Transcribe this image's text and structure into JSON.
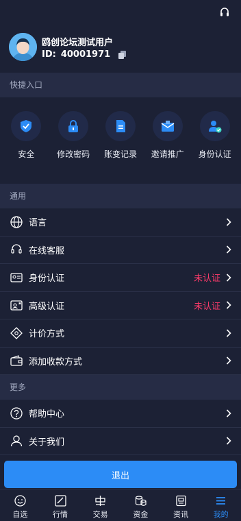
{
  "colors": {
    "background": "#1c2135",
    "section": "#262c45",
    "accent": "#2c8cf6",
    "warning": "#ff3b6b"
  },
  "header": {
    "support_icon": "headset-icon"
  },
  "profile": {
    "username": "鸥创论坛测试用户",
    "id_label": "ID:",
    "id_value": "40001971",
    "avatar_icon": "avatar-icon",
    "copy_icon": "copy-icon"
  },
  "quick_section": {
    "title": "快捷入口",
    "items": [
      {
        "label": "安全",
        "icon": "shield-icon"
      },
      {
        "label": "修改密码",
        "icon": "lock-icon"
      },
      {
        "label": "账变记录",
        "icon": "document-icon"
      },
      {
        "label": "邀请推广",
        "icon": "mail-icon"
      },
      {
        "label": "身份认证",
        "icon": "user-verified-icon"
      }
    ]
  },
  "general_section": {
    "title": "通用",
    "items": [
      {
        "label": "语言",
        "status": "",
        "icon": "globe-icon"
      },
      {
        "label": "在线客服",
        "status": "",
        "icon": "headset-icon"
      },
      {
        "label": "身份认证",
        "status": "未认证",
        "icon": "id-card-icon"
      },
      {
        "label": "高级认证",
        "status": "未认证",
        "icon": "id-card-star-icon"
      },
      {
        "label": "计价方式",
        "status": "",
        "icon": "currency-icon"
      },
      {
        "label": "添加收款方式",
        "status": "",
        "icon": "wallet-icon"
      }
    ]
  },
  "more_section": {
    "title": "更多",
    "items": [
      {
        "label": "帮助中心",
        "icon": "question-icon"
      },
      {
        "label": "关于我们",
        "icon": "person-icon"
      }
    ]
  },
  "logout": {
    "label": "退出"
  },
  "tabs": [
    {
      "label": "自选",
      "icon": "smile-icon",
      "active": false
    },
    {
      "label": "行情",
      "icon": "chart-icon",
      "active": false
    },
    {
      "label": "交易",
      "icon": "trade-icon",
      "active": false
    },
    {
      "label": "资金",
      "icon": "coins-icon",
      "active": false
    },
    {
      "label": "资讯",
      "icon": "news-icon",
      "active": false
    },
    {
      "label": "我的",
      "icon": "menu-icon",
      "active": true
    }
  ]
}
